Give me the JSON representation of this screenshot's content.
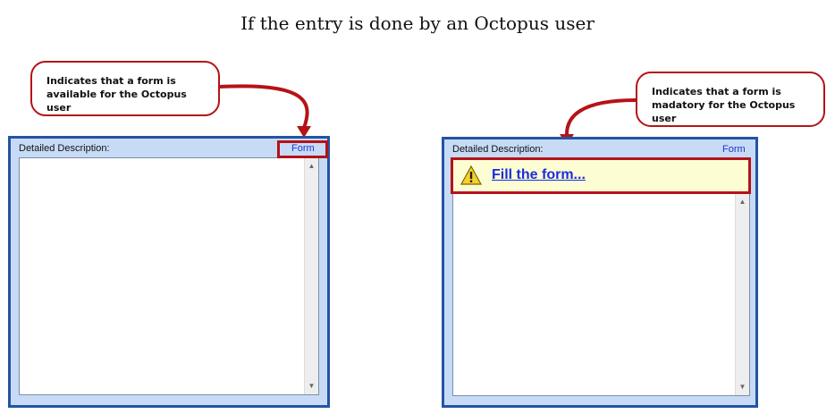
{
  "title": "If the entry is done by an Octopus user",
  "callouts": {
    "left": "Indicates that a form is available for the Octopus user",
    "right": "Indicates that a form is madatory for the Octopus user"
  },
  "panel_left": {
    "label": "Detailed Description:",
    "form_link": "Form"
  },
  "panel_right": {
    "label": "Detailed Description:",
    "form_link": "Form",
    "fill_link": "Fill the form..."
  },
  "icons": {
    "warning": "warning-icon",
    "scroll_up": "scroll-up-arrow-icon",
    "scroll_down": "scroll-down-arrow-icon"
  },
  "colors": {
    "annotation_red": "#b51218",
    "panel_border": "#2553a3",
    "panel_fill": "#c7dbf6",
    "link_blue": "#1a2de0",
    "banner_fill": "#fdfdd4"
  }
}
